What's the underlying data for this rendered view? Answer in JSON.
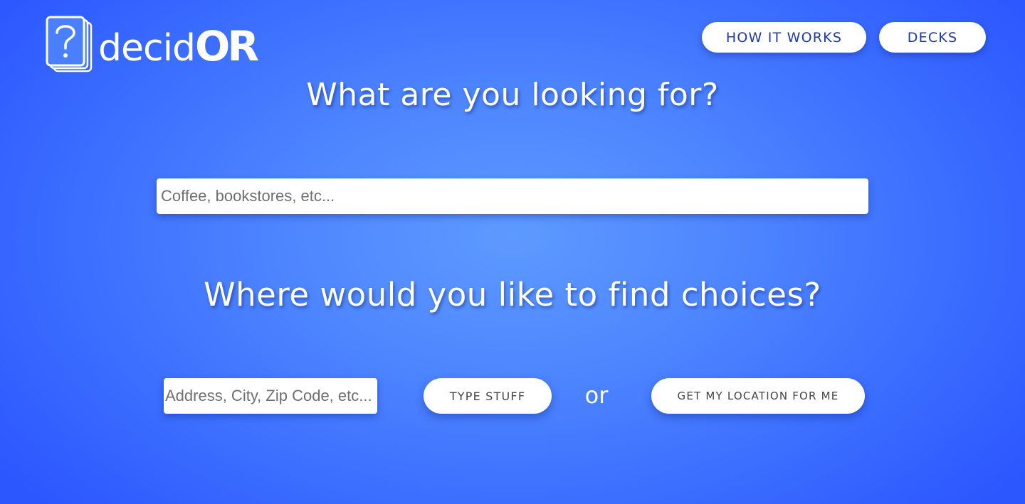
{
  "brand": {
    "logo_text_lower": "decid",
    "logo_text_upper": "OR",
    "logo_icon": "question-cards-icon"
  },
  "nav": {
    "how_it_works_label": "HOW IT WORKS",
    "decks_label": "DECKS"
  },
  "search": {
    "heading": "What are you looking for?",
    "placeholder": "Coffee, bookstores, etc...",
    "value": ""
  },
  "location": {
    "heading": "Where would you like to find choices?",
    "placeholder": "Address, City, Zip Code, etc...",
    "value": "",
    "type_stuff_label": "TYPE STUFF",
    "or_text": "or",
    "geolocate_label": "GET MY LOCATION FOR ME"
  },
  "colors": {
    "background_center": "#5d9aff",
    "background_edge": "#2c57ff",
    "nav_text": "#1c3aa8",
    "button_text": "#444444"
  }
}
